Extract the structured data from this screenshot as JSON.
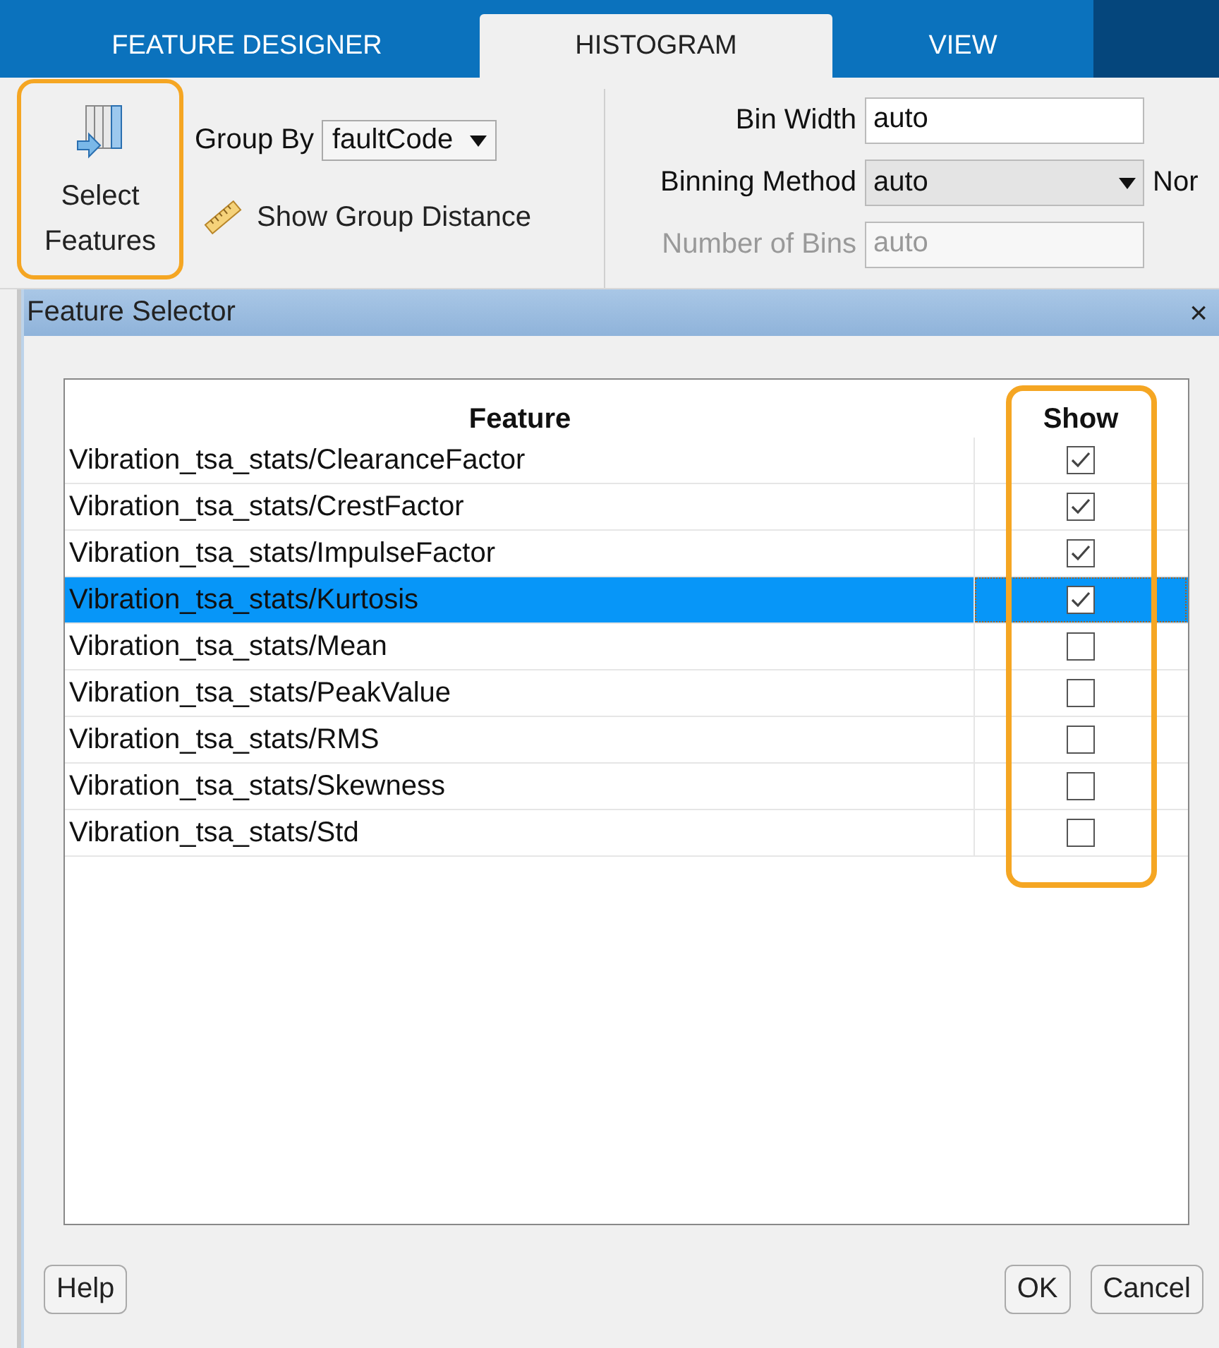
{
  "tabs": [
    {
      "label": "FEATURE DESIGNER",
      "selected": false
    },
    {
      "label": "HISTOGRAM",
      "selected": true
    },
    {
      "label": "VIEW",
      "selected": false
    }
  ],
  "toolstrip": {
    "select_features": {
      "label": "Select Features",
      "highlighted": true
    },
    "group_by": {
      "label": "Group By",
      "value": "faultCode"
    },
    "show_group_distance": "Show Group Distance",
    "fields": [
      {
        "label": "Bin Width",
        "value": "auto",
        "kind": "text",
        "disabled": false
      },
      {
        "label": "Binning Method",
        "value": "auto",
        "kind": "dropdown",
        "disabled": false
      },
      {
        "label": "Number of Bins",
        "value": "auto",
        "kind": "text",
        "disabled": true
      }
    ],
    "cut_label": "Nor"
  },
  "dialog": {
    "title": "Feature Selector",
    "close": "×",
    "columns": [
      "Feature",
      "Show"
    ],
    "show_column_highlighted": true,
    "rows": [
      {
        "feature": "Vibration_tsa_stats/ClearanceFactor",
        "show": true,
        "selected": false
      },
      {
        "feature": "Vibration_tsa_stats/CrestFactor",
        "show": true,
        "selected": false
      },
      {
        "feature": "Vibration_tsa_stats/ImpulseFactor",
        "show": true,
        "selected": false
      },
      {
        "feature": "Vibration_tsa_stats/Kurtosis",
        "show": true,
        "selected": true
      },
      {
        "feature": "Vibration_tsa_stats/Mean",
        "show": false,
        "selected": false
      },
      {
        "feature": "Vibration_tsa_stats/PeakValue",
        "show": false,
        "selected": false
      },
      {
        "feature": "Vibration_tsa_stats/RMS",
        "show": false,
        "selected": false
      },
      {
        "feature": "Vibration_tsa_stats/Skewness",
        "show": false,
        "selected": false
      },
      {
        "feature": "Vibration_tsa_stats/Std",
        "show": false,
        "selected": false
      }
    ],
    "buttons": {
      "help": "Help",
      "ok": "OK",
      "cancel": "Cancel"
    }
  }
}
